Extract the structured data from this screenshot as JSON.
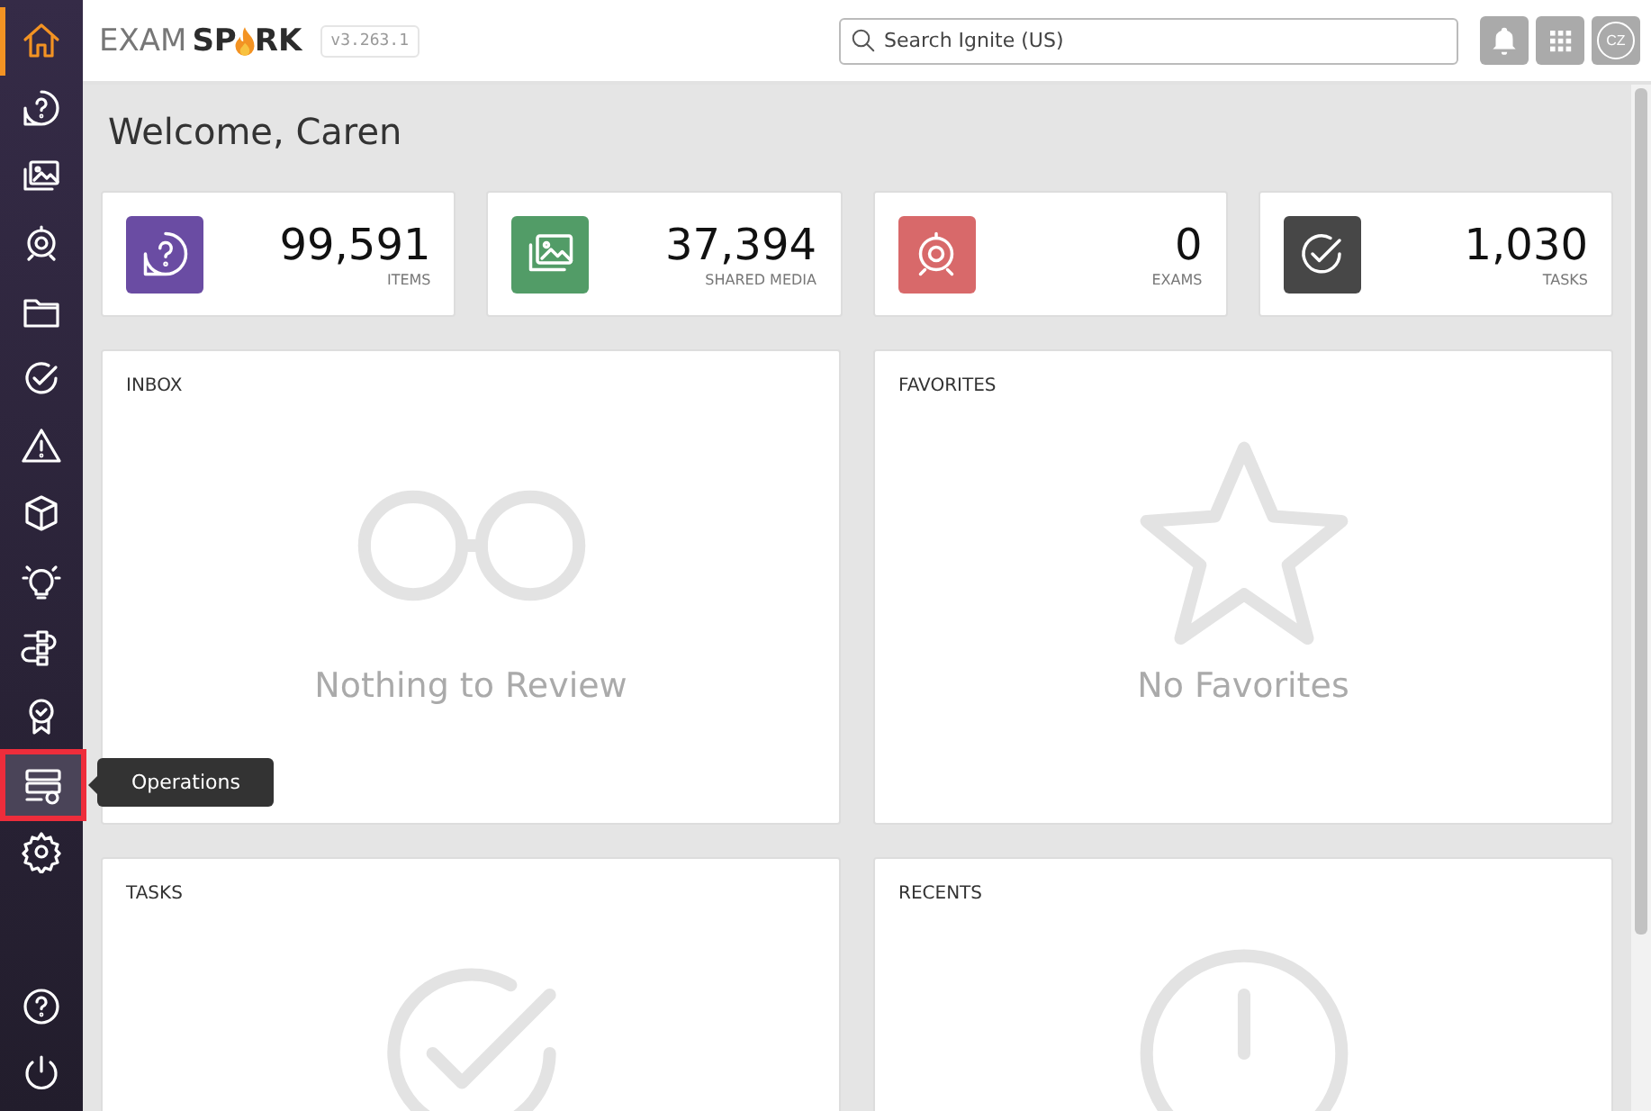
{
  "sidebar": {
    "items": [
      {
        "kind": "home",
        "selected": true,
        "focused": false
      },
      {
        "kind": "question",
        "selected": false,
        "focused": false
      },
      {
        "kind": "media",
        "selected": false,
        "focused": false
      },
      {
        "kind": "exam",
        "selected": false,
        "focused": false
      },
      {
        "kind": "folder",
        "selected": false,
        "focused": false
      },
      {
        "kind": "check",
        "selected": false,
        "focused": false
      },
      {
        "kind": "warning",
        "selected": false,
        "focused": false
      },
      {
        "kind": "cube",
        "selected": false,
        "focused": false
      },
      {
        "kind": "bulb",
        "selected": false,
        "focused": false
      },
      {
        "kind": "workflow",
        "selected": false,
        "focused": false
      },
      {
        "kind": "award",
        "selected": false,
        "focused": false
      },
      {
        "kind": "operations",
        "selected": false,
        "focused": true
      },
      {
        "kind": "settings",
        "selected": false,
        "focused": false
      }
    ],
    "bottom_items": [
      {
        "kind": "help"
      },
      {
        "kind": "power"
      }
    ],
    "tooltip": "Operations"
  },
  "header": {
    "logo": {
      "light": "EXAM",
      "bold_start": "SP",
      "bold_end": "RK"
    },
    "version": "v3.263.1",
    "search": {
      "placeholder": "Search Ignite (US)"
    },
    "avatar": "CZ"
  },
  "welcome": "Welcome, Caren",
  "stats": [
    {
      "kind": "question",
      "value": "99,591",
      "label": "ITEMS",
      "color": "#6a4ca3"
    },
    {
      "kind": "media",
      "value": "37,394",
      "label": "SHARED MEDIA",
      "color": "#529c67"
    },
    {
      "kind": "exam",
      "value": "0",
      "label": "EXAMS",
      "color": "#d8696a"
    },
    {
      "kind": "check",
      "value": "1,030",
      "label": "TASKS",
      "color": "#474747"
    }
  ],
  "panels": [
    {
      "kind": "glasses",
      "title": "INBOX",
      "empty_text": "Nothing to Review"
    },
    {
      "kind": "star",
      "title": "FAVORITES",
      "empty_text": "No Favorites"
    },
    {
      "kind": "check",
      "title": "TASKS"
    },
    {
      "kind": "clock",
      "title": "RECENTS"
    }
  ]
}
